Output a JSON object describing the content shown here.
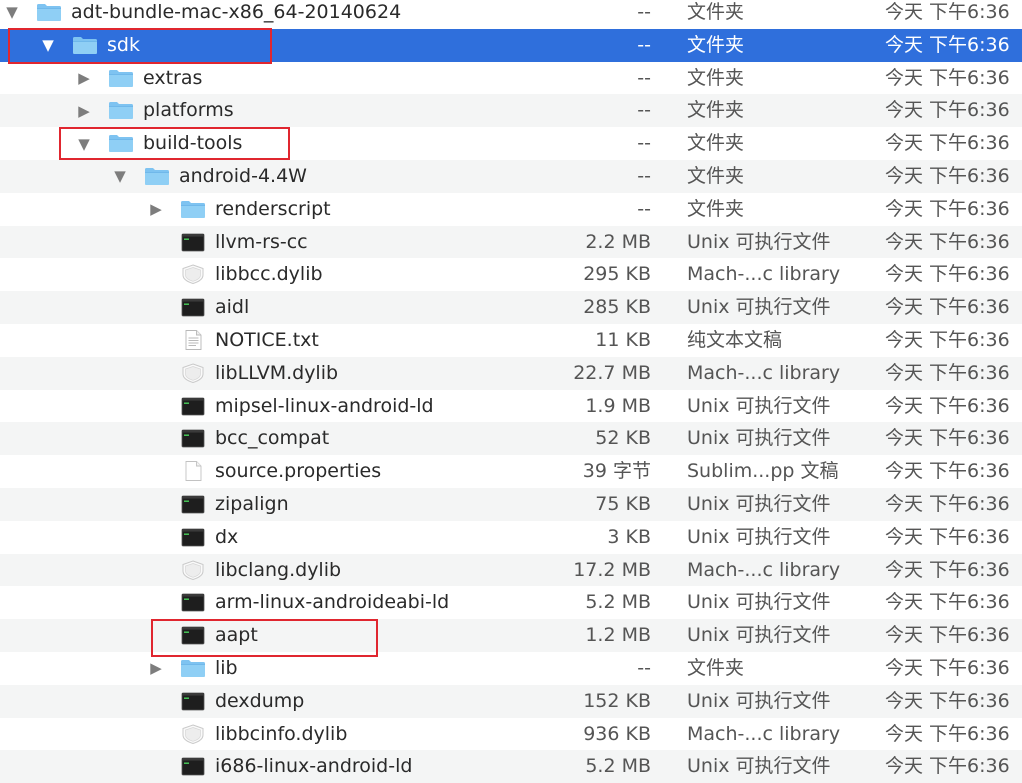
{
  "colors": {
    "selection": "#2f6fdc",
    "alt_row": "#f4f5f5",
    "highlight_box": "#e0262f",
    "folder": "#7ec3f1"
  },
  "rows": [
    {
      "id": "adt",
      "level": 0,
      "disclosure": "open",
      "icon": "folder-icon",
      "name": "adt-bundle-mac-x86_64-20140624",
      "size": "--",
      "kind": "文件夹",
      "date": "今天 下午6:36",
      "selected": false
    },
    {
      "id": "sdk",
      "level": 1,
      "disclosure": "open",
      "icon": "folder-icon",
      "name": "sdk",
      "size": "--",
      "kind": "文件夹",
      "date": "今天 下午6:36",
      "selected": true
    },
    {
      "id": "extras",
      "level": 2,
      "disclosure": "closed",
      "icon": "folder-icon",
      "name": "extras",
      "size": "--",
      "kind": "文件夹",
      "date": "今天 下午6:36",
      "selected": false
    },
    {
      "id": "platforms",
      "level": 2,
      "disclosure": "closed",
      "icon": "folder-icon",
      "name": "platforms",
      "size": "--",
      "kind": "文件夹",
      "date": "今天 下午6:36",
      "selected": false
    },
    {
      "id": "build-tools",
      "level": 2,
      "disclosure": "open",
      "icon": "folder-icon",
      "name": "build-tools",
      "size": "--",
      "kind": "文件夹",
      "date": "今天 下午6:36",
      "selected": false
    },
    {
      "id": "android-4-4w",
      "level": 3,
      "disclosure": "open",
      "icon": "folder-icon",
      "name": "android-4.4W",
      "size": "--",
      "kind": "文件夹",
      "date": "今天 下午6:36",
      "selected": false
    },
    {
      "id": "renderscript",
      "level": 4,
      "disclosure": "closed",
      "icon": "folder-icon",
      "name": "renderscript",
      "size": "--",
      "kind": "文件夹",
      "date": "今天 下午6:36",
      "selected": false
    },
    {
      "id": "llvm-rs-cc",
      "level": 4,
      "disclosure": "none",
      "icon": "terminal-icon",
      "name": "llvm-rs-cc",
      "size": "2.2 MB",
      "kind": "Unix 可执行文件",
      "date": "今天 下午6:36",
      "selected": false
    },
    {
      "id": "libbcc",
      "level": 4,
      "disclosure": "none",
      "icon": "library-icon",
      "name": "libbcc.dylib",
      "size": "295 KB",
      "kind": "Mach-...c library",
      "date": "今天 下午6:36",
      "selected": false
    },
    {
      "id": "aidl",
      "level": 4,
      "disclosure": "none",
      "icon": "terminal-icon",
      "name": "aidl",
      "size": "285 KB",
      "kind": "Unix 可执行文件",
      "date": "今天 下午6:36",
      "selected": false
    },
    {
      "id": "notice",
      "level": 4,
      "disclosure": "none",
      "icon": "text-document-icon",
      "name": "NOTICE.txt",
      "size": "11 KB",
      "kind": "纯文本文稿",
      "date": "今天 下午6:36",
      "selected": false
    },
    {
      "id": "libllvm",
      "level": 4,
      "disclosure": "none",
      "icon": "library-icon",
      "name": "libLLVM.dylib",
      "size": "22.7 MB",
      "kind": "Mach-...c library",
      "date": "今天 下午6:36",
      "selected": false
    },
    {
      "id": "mipsel",
      "level": 4,
      "disclosure": "none",
      "icon": "terminal-icon",
      "name": "mipsel-linux-android-ld",
      "size": "1.9 MB",
      "kind": "Unix 可执行文件",
      "date": "今天 下午6:36",
      "selected": false
    },
    {
      "id": "bcc-compat",
      "level": 4,
      "disclosure": "none",
      "icon": "terminal-icon",
      "name": "bcc_compat",
      "size": "52 KB",
      "kind": "Unix 可执行文件",
      "date": "今天 下午6:36",
      "selected": false
    },
    {
      "id": "source-properties",
      "level": 4,
      "disclosure": "none",
      "icon": "blank-document-icon",
      "name": "source.properties",
      "size": "39 字节",
      "kind": "Sublim...pp 文稿",
      "date": "今天 下午6:36",
      "selected": false
    },
    {
      "id": "zipalign",
      "level": 4,
      "disclosure": "none",
      "icon": "terminal-icon",
      "name": "zipalign",
      "size": "75 KB",
      "kind": "Unix 可执行文件",
      "date": "今天 下午6:36",
      "selected": false
    },
    {
      "id": "dx",
      "level": 4,
      "disclosure": "none",
      "icon": "terminal-icon",
      "name": "dx",
      "size": "3 KB",
      "kind": "Unix 可执行文件",
      "date": "今天 下午6:36",
      "selected": false
    },
    {
      "id": "libclang",
      "level": 4,
      "disclosure": "none",
      "icon": "library-icon",
      "name": "libclang.dylib",
      "size": "17.2 MB",
      "kind": "Mach-...c library",
      "date": "今天 下午6:36",
      "selected": false
    },
    {
      "id": "arm-linux",
      "level": 4,
      "disclosure": "none",
      "icon": "terminal-icon",
      "name": "arm-linux-androideabi-ld",
      "size": "5.2 MB",
      "kind": "Unix 可执行文件",
      "date": "今天 下午6:36",
      "selected": false
    },
    {
      "id": "aapt",
      "level": 4,
      "disclosure": "none",
      "icon": "terminal-icon",
      "name": "aapt",
      "size": "1.2 MB",
      "kind": "Unix 可执行文件",
      "date": "今天 下午6:36",
      "selected": false
    },
    {
      "id": "lib",
      "level": 4,
      "disclosure": "closed",
      "icon": "folder-icon",
      "name": "lib",
      "size": "--",
      "kind": "文件夹",
      "date": "今天 下午6:36",
      "selected": false
    },
    {
      "id": "dexdump",
      "level": 4,
      "disclosure": "none",
      "icon": "terminal-icon",
      "name": "dexdump",
      "size": "152 KB",
      "kind": "Unix 可执行文件",
      "date": "今天 下午6:36",
      "selected": false
    },
    {
      "id": "libbcinfo",
      "level": 4,
      "disclosure": "none",
      "icon": "library-icon",
      "name": "libbcinfo.dylib",
      "size": "936 KB",
      "kind": "Mach-...c library",
      "date": "今天 下午6:36",
      "selected": false
    },
    {
      "id": "i686-linux",
      "level": 4,
      "disclosure": "none",
      "icon": "terminal-icon",
      "name": "i686-linux-android-ld",
      "size": "5.2 MB",
      "kind": "Unix 可执行文件",
      "date": "今天 下午6:36",
      "selected": false
    }
  ],
  "highlighted_rows": [
    "sdk",
    "build-tools",
    "aapt"
  ]
}
